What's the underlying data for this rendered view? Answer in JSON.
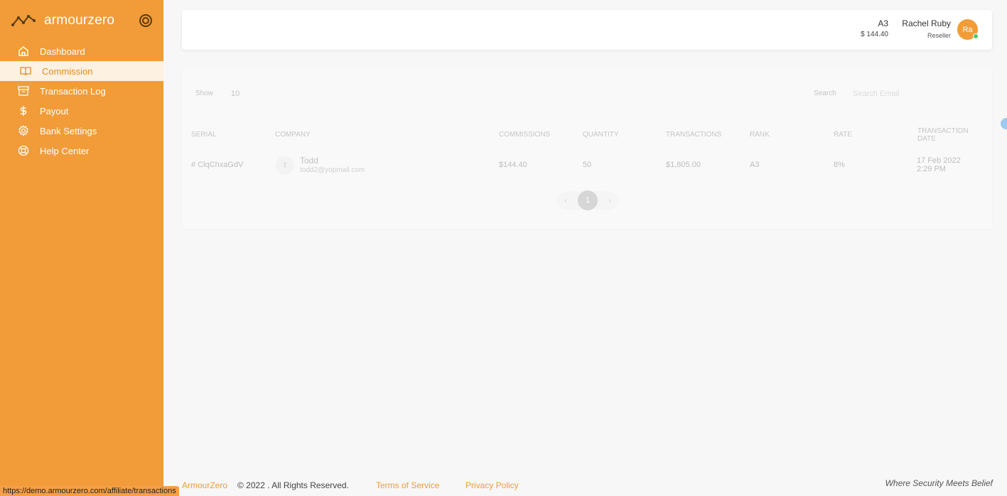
{
  "brand": {
    "name": "armourzero"
  },
  "nav": [
    {
      "label": "Dashboard",
      "icon": "home-icon"
    },
    {
      "label": "Commission",
      "icon": "book-icon",
      "active": true
    },
    {
      "label": "Transaction Log",
      "icon": "archive-icon"
    },
    {
      "label": "Payout",
      "icon": "dollar-icon"
    },
    {
      "label": "Bank Settings",
      "icon": "gear-icon"
    },
    {
      "label": "Help Center",
      "icon": "lifebuoy-icon"
    }
  ],
  "header": {
    "rank": "A3",
    "balance": "$ 144.40",
    "user_name": "Rachel Ruby",
    "user_role": "Reseller",
    "avatar_initials": "Ra"
  },
  "table": {
    "show_label": "Show",
    "show_value": "10",
    "search_label": "Search",
    "search_placeholder": "Search Email",
    "columns": [
      "SERIAL",
      "COMPANY",
      "COMMISSIONS",
      "QUANTITY",
      "TRANSACTIONS",
      "RANK",
      "RATE",
      "TRANSACTION DATE"
    ],
    "rows": [
      {
        "serial": "# ClqChxaGdV",
        "company_initial": "T",
        "company_name": "Todd",
        "company_email": "todd2@yopmail.com",
        "commissions": "$144.40",
        "quantity": "50",
        "transactions": "$1,805.00",
        "rank": "A3",
        "rate": "8%",
        "date": "17 Feb 2022",
        "time": "2:29 PM"
      }
    ],
    "pagination": {
      "prev": "‹",
      "current": "1",
      "next": "›"
    }
  },
  "footer": {
    "brand": "ArmourZero",
    "copyright": "© 2022 . All Rights Reserved.",
    "terms": "Terms of Service",
    "privacy": "Privacy Policy",
    "tagline": "Where Security Meets Belief"
  },
  "status_url": "https://demo.armourzero.com/affiliate/transactions",
  "colors": {
    "accent": "#f19c38",
    "active_bg": "#fdf1e1",
    "online": "#4cc96a"
  }
}
